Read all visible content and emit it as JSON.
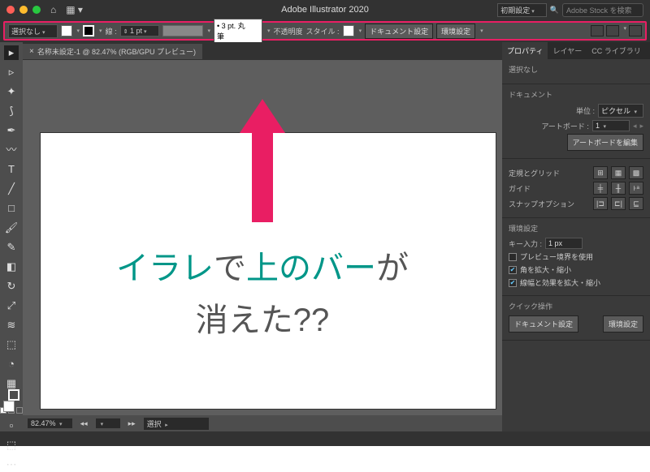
{
  "titlebar": {
    "app_title": "Adobe Illustrator 2020",
    "workspace_label": "初期設定",
    "search_placeholder": "Adobe Stock を検索"
  },
  "controlbar": {
    "selection": "選択なし",
    "stroke_label": "線 :",
    "stroke_value": "1 pt",
    "brush_value": "3 pt. 丸筆",
    "opacity_label": "不透明度",
    "style_label": "スタイル :",
    "doc_setup": "ドキュメント設定",
    "pref": "環境設定"
  },
  "doc_tab": {
    "label": "名称未設定-1 @ 82.47% (RGB/GPU プレビュー)"
  },
  "annotation": {
    "line1_1": "イラレ",
    "line1_2": "で",
    "line1_3": "上のバー",
    "line1_4": "が",
    "line2": "消えた??"
  },
  "statusbar": {
    "zoom": "82.47%",
    "mode": "選択"
  },
  "panel": {
    "tabs": {
      "properties": "プロパティ",
      "layers": "レイヤー",
      "cc": "CC ライブラリ"
    },
    "no_selection": "選択なし",
    "document": "ドキュメント",
    "units_label": "単位 :",
    "units_value": "ピクセル",
    "artboard_label": "アートボード :",
    "artboard_value": "1",
    "edit_artboard": "アートボードを編集",
    "ruler_grid": "定規とグリッド",
    "guides": "ガイド",
    "snap_options": "スナップオプション",
    "pref": "環境設定",
    "key_input_label": "キー入力 :",
    "key_input_value": "1 px",
    "preview_bounds": "プレビュー境界を使用",
    "scale_corners": "角を拡大・縮小",
    "scale_strokes": "線幅と効果を拡大・縮小",
    "quick_actions": "クイック操作",
    "doc_setup_btn": "ドキュメント設定",
    "pref_btn": "環境設定"
  }
}
